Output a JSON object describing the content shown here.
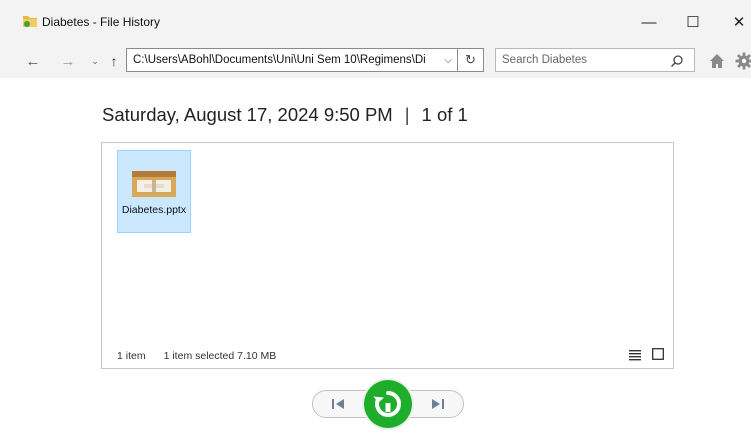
{
  "window": {
    "title": "Diabetes - File History",
    "controls": {
      "minimize": "—",
      "maximize": "☐",
      "close": "✕"
    }
  },
  "nav": {
    "back_glyph": "←",
    "forward_glyph": "→",
    "recent_glyph": "⌄",
    "up_glyph": "↑",
    "address": "C:\\Users\\ABohl\\Documents\\Uni\\Uni Sem 10\\Regimens\\Di",
    "dropdown_glyph": "⌵",
    "refresh_glyph": "↻",
    "search_placeholder": "Search Diabetes"
  },
  "snapshot": {
    "datetime": "Saturday, August 17, 2024 9:50 PM",
    "separator": "|",
    "position": "1 of 1"
  },
  "files": [
    {
      "name": "Diabetes.pptx",
      "selected": true,
      "icon": "presentation-file-icon"
    }
  ],
  "status_bar": {
    "item_count": "1 item",
    "selection": "1 item selected  7.10 MB"
  },
  "colors": {
    "selection_fill": "#cce8ff",
    "selection_border": "#99d1ff",
    "restore_green": "#1fae2b"
  }
}
